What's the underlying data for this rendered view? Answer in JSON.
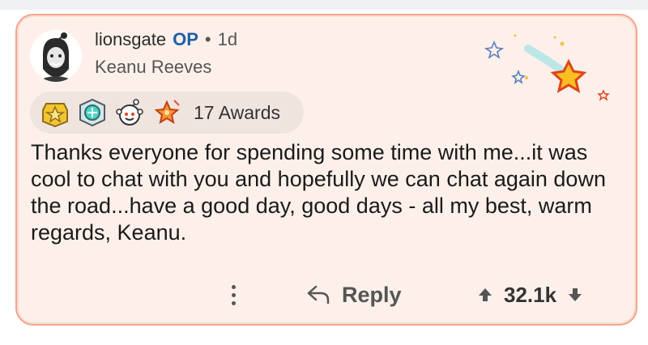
{
  "comment": {
    "username": "lionsgate",
    "op_badge": "OP",
    "separator": "•",
    "age": "1d",
    "flair": "Keanu Reeves",
    "awards_label": "17 Awards",
    "body": "Thanks everyone for spending some time with me...it was cool to chat with you and hopefully we can chat again down the road...have a good day, good days - all my best, warm regards, Keanu.",
    "reply_label": "Reply",
    "score": "32.1k"
  },
  "icons": {
    "avatar": "bearded-avatar",
    "awards": [
      "gold-star-award",
      "silver-award",
      "wholesome-award",
      "rocket-award"
    ],
    "decoration": "shooting-star-icon",
    "more": "more-options-icon",
    "reply": "reply-arrow-icon",
    "upvote": "upvote-arrow-icon",
    "downvote": "downvote-arrow-icon"
  },
  "colors": {
    "card_background": "#fdf0ea",
    "card_border": "#f1a58e",
    "op_blue": "#1f5fa8",
    "awards_pill": "#f0e4df"
  }
}
